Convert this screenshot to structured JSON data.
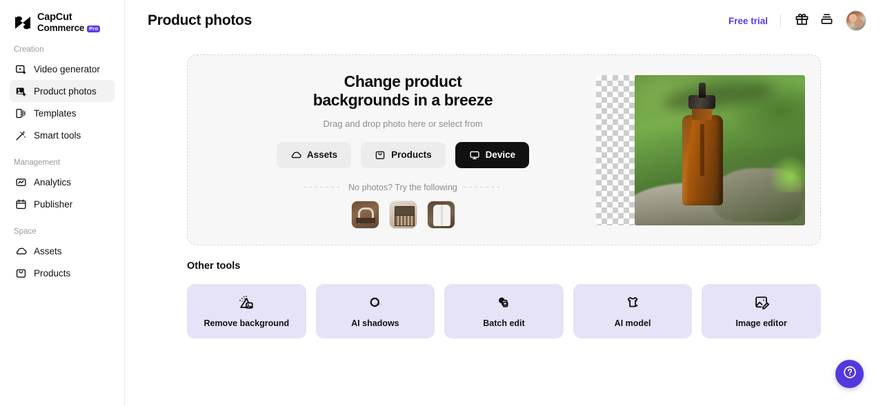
{
  "brand": {
    "line1": "CapCut",
    "line2": "Commerce",
    "badge": "Pro",
    "logo_icon": "capcut-logo-icon",
    "badge_color": "#5B3DE8"
  },
  "sidebar": {
    "sections": [
      {
        "label": "Creation",
        "items": [
          {
            "label": "Video generator",
            "icon": "video-generator-icon",
            "active": false
          },
          {
            "label": "Product photos",
            "icon": "product-photos-icon",
            "active": true
          },
          {
            "label": "Templates",
            "icon": "templates-icon",
            "active": false
          },
          {
            "label": "Smart tools",
            "icon": "smart-tools-icon",
            "active": false
          }
        ]
      },
      {
        "label": "Management",
        "items": [
          {
            "label": "Analytics",
            "icon": "analytics-icon",
            "active": false
          },
          {
            "label": "Publisher",
            "icon": "publisher-icon",
            "active": false
          }
        ]
      },
      {
        "label": "Space",
        "items": [
          {
            "label": "Assets",
            "icon": "cloud-assets-icon",
            "active": false
          },
          {
            "label": "Products",
            "icon": "products-bag-icon",
            "active": false
          }
        ]
      }
    ]
  },
  "header": {
    "title": "Product photos",
    "free_trial": "Free trial",
    "free_trial_color": "#5B3DE8",
    "gift_icon": "gift-icon",
    "stack_icon": "stack-layers-icon",
    "avatar": "user-avatar"
  },
  "hero": {
    "heading_line1": "Change product",
    "heading_line2": "backgrounds in a breeze",
    "subtitle": "Drag and drop photo here or select from",
    "buttons": [
      {
        "label": "Assets",
        "icon": "cloud-icon",
        "style": "light"
      },
      {
        "label": "Products",
        "icon": "bag-icon",
        "style": "light"
      },
      {
        "label": "Device",
        "icon": "monitor-icon",
        "style": "dark"
      }
    ],
    "divider_text": "No photos? Try the following",
    "samples": [
      {
        "name": "headphones-sample"
      },
      {
        "name": "makeup-palette-sample"
      },
      {
        "name": "white-shirt-sample"
      }
    ],
    "preview": {
      "name": "amber-dropper-bottle-preview",
      "description": "Amber dropper bottle on mossy rock with green background"
    }
  },
  "other_tools": {
    "title": "Other tools",
    "cards": [
      {
        "label": "Remove background",
        "icon": "remove-background-icon"
      },
      {
        "label": "AI shadows",
        "icon": "ai-shadows-icon"
      },
      {
        "label": "Batch edit",
        "icon": "batch-edit-icon"
      },
      {
        "label": "AI model",
        "icon": "ai-model-icon"
      },
      {
        "label": "Image editor",
        "icon": "image-editor-icon"
      }
    ],
    "card_color": "#E6E2F8"
  },
  "help": {
    "icon": "help-question-icon",
    "color": "#5338DE"
  }
}
